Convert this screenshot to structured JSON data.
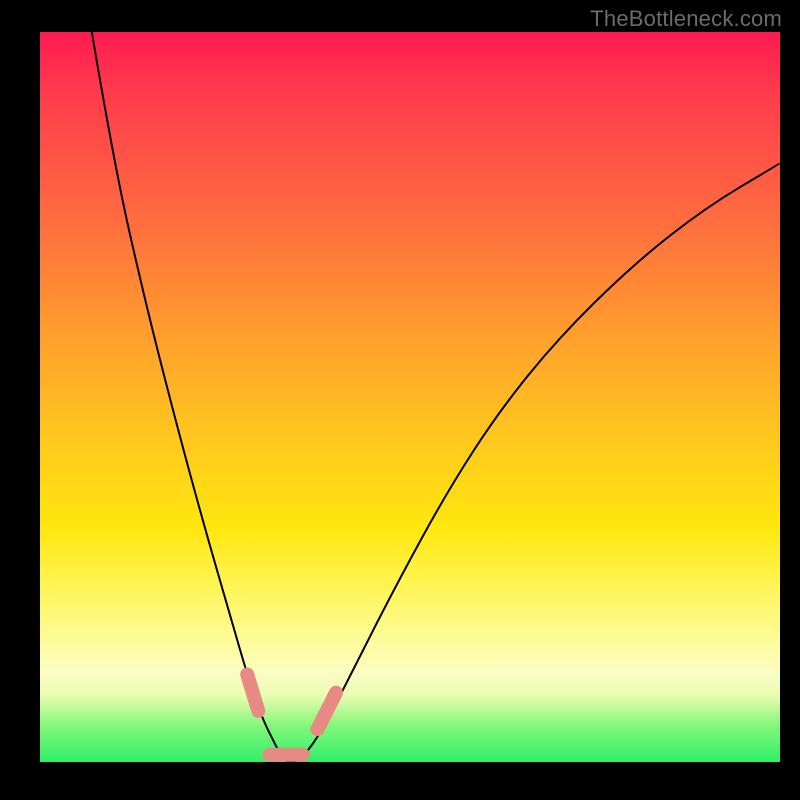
{
  "watermark": "TheBottleneck.com",
  "chart_data": {
    "type": "line",
    "title": "",
    "xlabel": "",
    "ylabel": "",
    "xlim": [
      0,
      100
    ],
    "ylim": [
      0,
      100
    ],
    "series": [
      {
        "name": "bottleneck-curve",
        "x": [
          7,
          10,
          14,
          18,
          22,
          26,
          28,
          30,
          32,
          33,
          35,
          38,
          42,
          48,
          55,
          62,
          70,
          80,
          90,
          100
        ],
        "y": [
          100,
          82,
          64,
          48,
          33,
          19,
          12,
          6,
          2,
          0,
          0,
          4,
          12,
          24,
          37,
          48,
          58,
          68,
          76,
          82
        ]
      }
    ],
    "markers": [
      {
        "name": "left-descent-marker",
        "x0": 28.0,
        "y0": 12.0,
        "x1": 29.5,
        "y1": 7.0
      },
      {
        "name": "valley-marker",
        "x0": 31.0,
        "y0": 1.0,
        "x1": 35.5,
        "y1": 1.0
      },
      {
        "name": "right-ascent-marker",
        "x0": 37.5,
        "y0": 4.5,
        "x1": 40.0,
        "y1": 9.5
      }
    ],
    "gradient_stops": [
      {
        "pos": 0,
        "color": "#ff1a51"
      },
      {
        "pos": 55,
        "color": "#ffc61f"
      },
      {
        "pos": 84,
        "color": "#fdfca0"
      },
      {
        "pos": 100,
        "color": "#2ef06a"
      }
    ]
  }
}
